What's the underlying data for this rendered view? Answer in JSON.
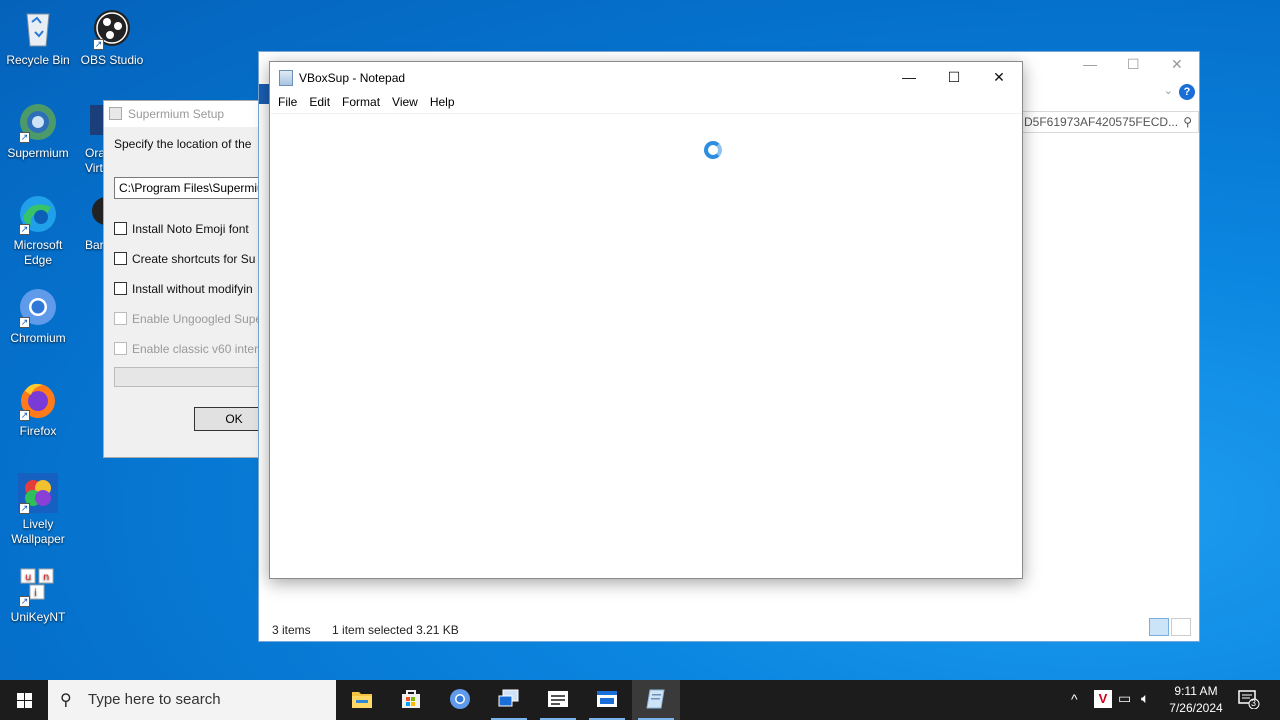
{
  "desktop_icons": [
    {
      "label": "Recycle Bin"
    },
    {
      "label": "OBS Studio"
    },
    {
      "label": "Supermium"
    },
    {
      "label": "Ora Virt"
    },
    {
      "label": "Microsoft Edge"
    },
    {
      "label": "Bar"
    },
    {
      "label": "Chromium"
    },
    {
      "label": "Firefox"
    },
    {
      "label": "Lively Wallpaper"
    },
    {
      "label": "UniKeyNT"
    }
  ],
  "setup_dialog": {
    "title": "Supermium Setup",
    "description": "Specify the location of the",
    "path_value": "C:\\Program Files\\Supermiu",
    "checkboxes": [
      {
        "label": "Install Noto Emoji font",
        "checked": false,
        "enabled": true
      },
      {
        "label": "Create shortcuts for Su",
        "checked": false,
        "enabled": true
      },
      {
        "label": "Install without modifyin",
        "checked": false,
        "enabled": true
      },
      {
        "label": "Enable Ungoogled Supe",
        "checked": false,
        "enabled": false
      },
      {
        "label": "Enable classic v60 inter",
        "checked": false,
        "enabled": false
      }
    ],
    "ok_label": "OK"
  },
  "explorer": {
    "address_text": "D5F61973AF420575FECD...",
    "status_items": "3 items",
    "status_selected": "1 item selected  3.21 KB"
  },
  "notepad": {
    "title": "VBoxSup - Notepad",
    "menu": [
      "File",
      "Edit",
      "Format",
      "View",
      "Help"
    ]
  },
  "taskbar": {
    "search_placeholder": "Type here to search",
    "clock_time": "9:11 AM",
    "clock_date": "7/26/2024",
    "notification_count": "3",
    "apps": [
      "File Explorer",
      "Microsoft Store",
      "Chromium",
      "Remote Desktop",
      "Task Window",
      "Setup",
      "Notepad"
    ]
  }
}
